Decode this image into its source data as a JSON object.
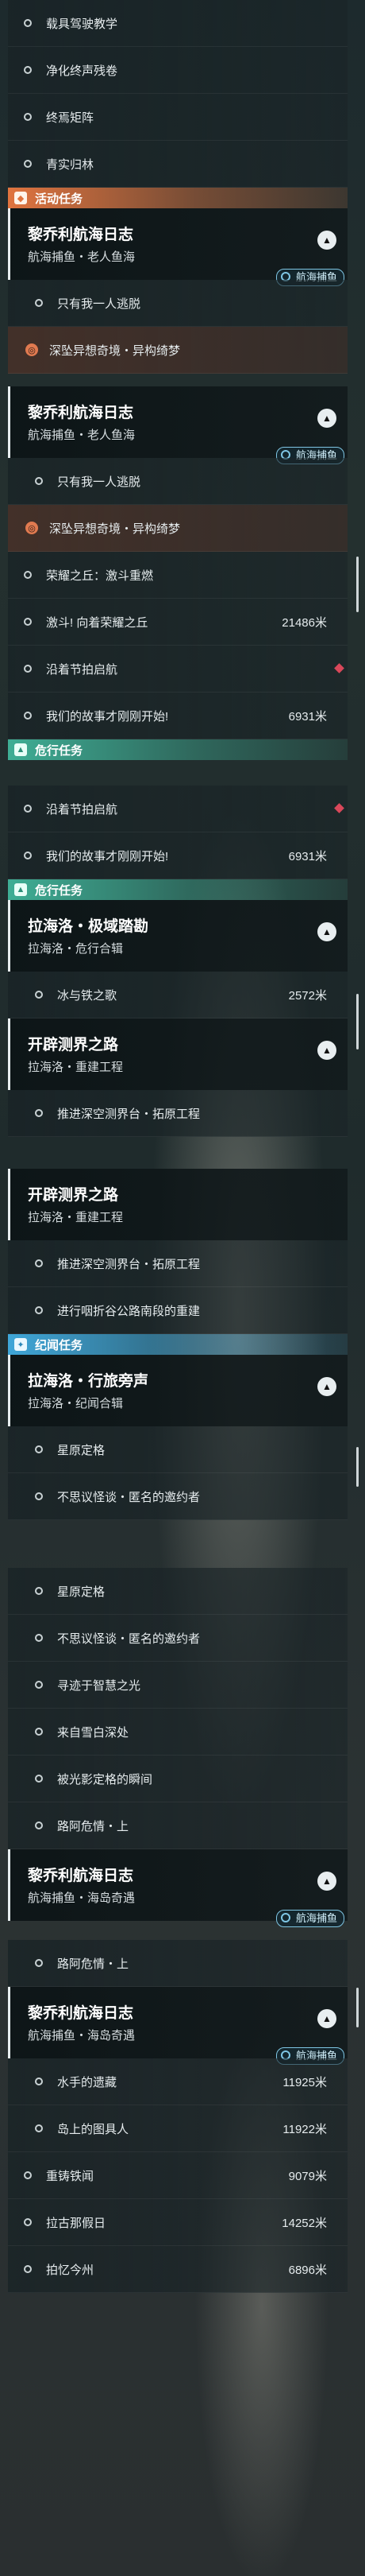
{
  "top_items": [
    "载具驾驶教学",
    "净化终声残卷",
    "终焉矩阵",
    "青实归林"
  ],
  "sections": {
    "activity": "活动任务",
    "danger": "危行任务",
    "chronicle": "纪闻任务"
  },
  "cards": {
    "c1": {
      "title": "黎乔利航海日志",
      "subtitle": "航海捕鱼・老人鱼海",
      "badge": "航海捕鱼"
    },
    "c2": {
      "title": "黎乔利航海日志",
      "subtitle": "航海捕鱼・老人鱼海",
      "badge": "航海捕鱼"
    },
    "c3": {
      "title": "拉海洛・极域踏勘",
      "subtitle": "拉海洛・危行合辑"
    },
    "c4": {
      "title": "开辟测界之路",
      "subtitle": "拉海洛・重建工程"
    },
    "c5": {
      "title": "开辟测界之路",
      "subtitle": "拉海洛・重建工程"
    },
    "c6": {
      "title": "拉海洛・行旅旁声",
      "subtitle": "拉海洛・纪闻合辑"
    },
    "c7": {
      "title": "黎乔利航海日志",
      "subtitle": "航海捕鱼・海岛奇遇",
      "badge": "航海捕鱼"
    },
    "c8": {
      "title": "黎乔利航海日志",
      "subtitle": "航海捕鱼・海岛奇遇",
      "badge": "航海捕鱼"
    }
  },
  "rows": {
    "only_me_1": "只有我一人逃脱",
    "abyss_1": "深坠异想奇境・异构绮梦",
    "only_me_2": "只有我一人逃脱",
    "abyss_2": "深坠异想奇境・异构绮梦",
    "glory_1": "荣耀之丘：激斗重燃",
    "charge": "激斗! 向着荣耀之丘",
    "charge_dist": "21486米",
    "festival_1": "沿着节拍启航",
    "story_1": "我们的故事才刚刚开始!",
    "story_1_dist": "6931米",
    "festival_2": "沿着节拍启航",
    "story_2": "我们的故事才刚刚开始!",
    "story_2_dist": "6931米",
    "ice_fire": "冰与铁之歌",
    "ice_fire_dist": "2572米",
    "promote_1": "推进深空测界台・拓原工程",
    "promote_2": "推进深空测界台・拓原工程",
    "highway": "进行咽折谷公路南段的重建",
    "star_1": "星原定格",
    "wonder_1": "不思议怪谈・匿名的邀约者",
    "star_2": "星原定格",
    "wonder_2": "不思议怪谈・匿名的邀约者",
    "wisdom": "寻迹于智慧之光",
    "white_deep": "来自雪白深处",
    "shadow": "被光影定格的瞬间",
    "danger_road_1": "路阿危情・上",
    "danger_road_2": "路阿危情・上",
    "sailor": "水手的遗藏",
    "sailor_dist": "11925米",
    "island": "岛上的图具人",
    "island_dist": "11922米",
    "heavy": "重铸铁闻",
    "heavy_dist": "9079米",
    "lagu": "拉古那假日",
    "lagu_dist": "14252米",
    "memory": "拍忆今州",
    "memory_dist": "6896米"
  },
  "colors": {
    "activity": "#e0743f",
    "danger": "#3fae95",
    "chronicle": "#3fa6d8",
    "badge": "#7fc6e4",
    "marker": "#d9485a"
  }
}
